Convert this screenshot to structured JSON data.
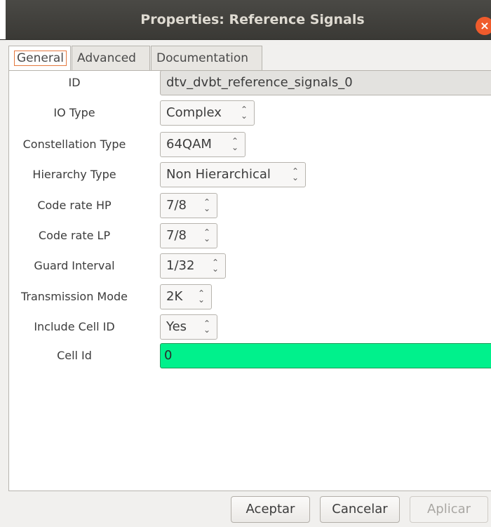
{
  "window": {
    "title": "Properties: Reference Signals",
    "close_glyph": "×"
  },
  "tabs": [
    {
      "label": "General",
      "active": true
    },
    {
      "label": "Advanced",
      "active": false
    },
    {
      "label": "Documentation",
      "active": false
    }
  ],
  "fields": {
    "id": {
      "label": "ID",
      "value": "dtv_dvbt_reference_signals_0"
    },
    "io_type": {
      "label": "IO Type",
      "value": "Complex"
    },
    "constellation_type": {
      "label": "Constellation Type",
      "value": "64QAM"
    },
    "hierarchy_type": {
      "label": "Hierarchy Type",
      "value": "Non Hierarchical"
    },
    "code_rate_hp": {
      "label": "Code rate HP",
      "value": "7/8"
    },
    "code_rate_lp": {
      "label": "Code rate LP",
      "value": "7/8"
    },
    "guard_interval": {
      "label": "Guard Interval",
      "value": "1/32"
    },
    "transmission_mode": {
      "label": "Transmission Mode",
      "value": "2K"
    },
    "include_cell_id": {
      "label": "Include Cell ID",
      "value": "Yes"
    },
    "cell_id": {
      "label": "Cell Id",
      "value": "0"
    }
  },
  "buttons": {
    "accept": "Aceptar",
    "cancel": "Cancelar",
    "apply": "Aplicar"
  },
  "colors": {
    "accent": "#e5793f",
    "cell_id_bg": "#00f18c",
    "close": "#ef5b2c"
  },
  "icons": {
    "combo_arrows": "updown-chevron-icon"
  }
}
